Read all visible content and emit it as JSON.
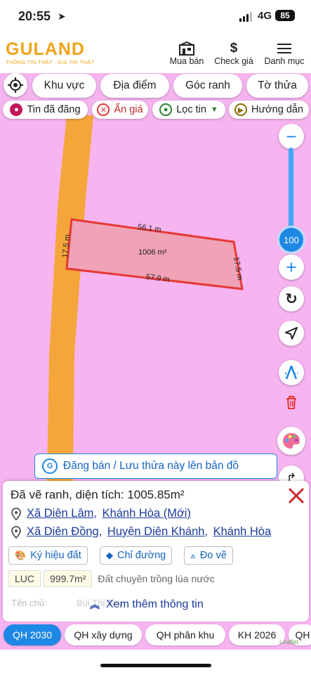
{
  "status": {
    "time": "20:55",
    "network": "4G",
    "battery": "85"
  },
  "header": {
    "logo": "GULAND",
    "tagline": "THÔNG TIN THẬT · GIÁ TRỊ THẬT",
    "buttons": [
      {
        "label": "Mua bán",
        "icon": "store-icon"
      },
      {
        "label": "Check giá",
        "icon": "dollar-icon"
      },
      {
        "label": "Danh mục",
        "icon": "menu-icon"
      }
    ]
  },
  "filters": {
    "row1": [
      "Khu vực",
      "Địa điểm",
      "Góc ranh",
      "Tờ thửa"
    ],
    "row2": [
      "Tin đã đăng",
      "Ẩn giá",
      "Lọc tin",
      "Hướng dẫn"
    ]
  },
  "map": {
    "zoom_level": "100",
    "parcel": {
      "top": "56.1 m",
      "bottom": "57.9 m",
      "left": "17.5 m",
      "right": "17.5 m",
      "area": "1006 m²"
    }
  },
  "banner": {
    "text": "Đăng bán / Lưu thửa này lên bản đồ"
  },
  "panel": {
    "title": "Đã vẽ ranh, diện tích: 1005.85m²",
    "address_new": [
      "Xã Diên Lâm",
      "Khánh Hòa (Mới)"
    ],
    "address_old": [
      "Xã Diên Đồng",
      "Huyện Diên Khánh",
      "Khánh Hòa"
    ],
    "tools": [
      "Ký hiệu đất",
      "Chỉ đường",
      "Đo vẽ"
    ],
    "land_code": "LUC",
    "land_area": "999.7m²",
    "land_desc": "Đất chuyên trồng lúa nước",
    "owner_label": "Tên chủ:",
    "owner_ghost": "Bùi Thị Thu ...",
    "more": "Xem thêm thông tin"
  },
  "tabs": [
    "QH 2030",
    "QH xây dựng",
    "QH phân khu",
    "KH 2026",
    "QH"
  ],
  "attribution": "Leaflet",
  "colors": {
    "accent": "#1e88e5",
    "map_bg": "#f6b4f0",
    "road": "#f5a63b",
    "parcel_stroke": "#e53935",
    "brand": "#f0a419"
  }
}
